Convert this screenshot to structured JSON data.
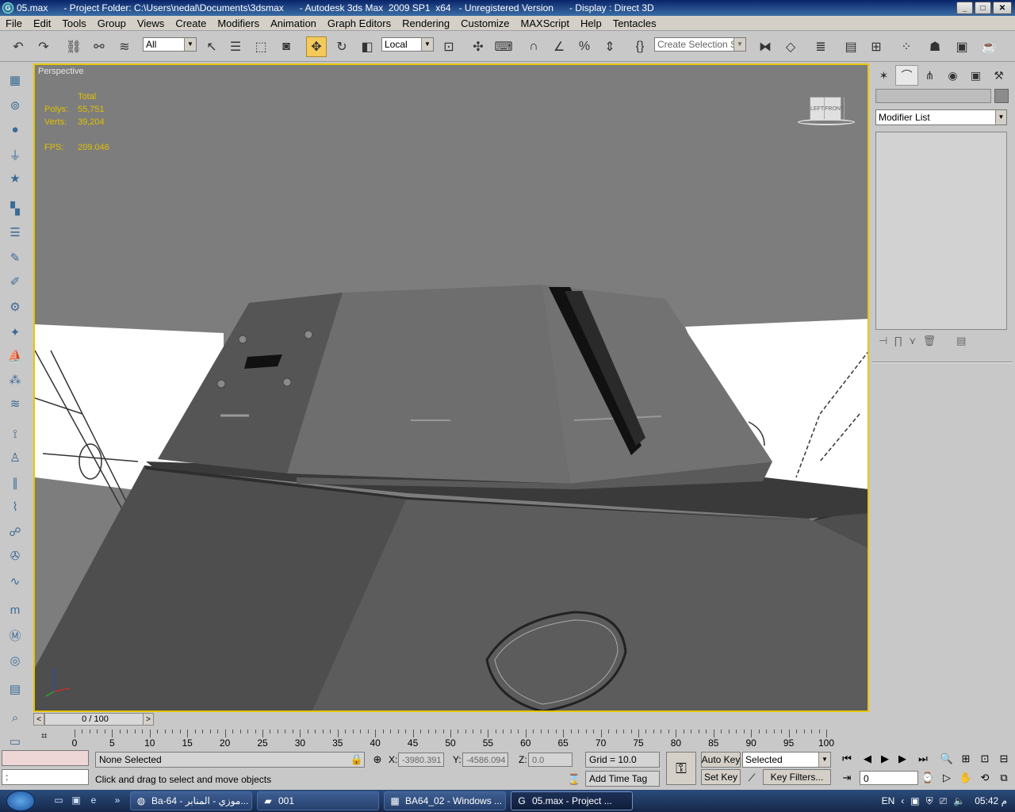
{
  "window": {
    "title": "05.max      - Project Folder: C:\\Users\\nedal\\Documents\\3dsmax      - Autodesk 3ds Max  2009 SP1  x64   - Unregistered Version      - Display : Direct 3D",
    "minimize": "_",
    "maximize": "□",
    "close": "✕"
  },
  "menu": [
    "File",
    "Edit",
    "Tools",
    "Group",
    "Views",
    "Create",
    "Modifiers",
    "Animation",
    "Graph Editors",
    "Rendering",
    "Customize",
    "MAXScript",
    "Help",
    "Tentacles"
  ],
  "toolbar": {
    "selection_filter": "All",
    "ref_coord": "Local",
    "named_selection_placeholder": "Create Selection Set"
  },
  "viewport": {
    "label": "Perspective",
    "stats": {
      "header": "Total",
      "polys_label": "Polys:",
      "polys": "55,751",
      "verts_label": "Verts:",
      "verts": "39,204",
      "fps_label": "FPS:",
      "fps": "209.046"
    },
    "viewcube_left": "LEFT",
    "viewcube_front": "FRONT"
  },
  "command_panel": {
    "modifier_list": "Modifier List"
  },
  "time_slider": {
    "position": "0 / 100",
    "prev": "<",
    "next": ">"
  },
  "trackbar": {
    "ticks": [
      "0",
      "5",
      "10",
      "15",
      "20",
      "25",
      "30",
      "35",
      "40",
      "45",
      "50",
      "55",
      "60",
      "65",
      "70",
      "75",
      "80",
      "85",
      "90",
      "95",
      "100"
    ]
  },
  "status": {
    "selection": "None Selected",
    "prompt": "Click and drag to select and move objects",
    "maxscript": ":",
    "x_label": "X:",
    "x": "-3980.391",
    "y_label": "Y:",
    "y": "-4586.094",
    "z_label": "Z:",
    "z": "0.0",
    "grid": "Grid = 10.0",
    "add_time_tag": "Add Time Tag",
    "auto_key": "Auto Key",
    "set_key": "Set Key",
    "key_mode": "Selected",
    "key_filters": "Key Filters...",
    "frame": "0"
  },
  "taskbar": {
    "tasks": [
      {
        "label": "Ba-64 - موزي - المنابر...",
        "icon": "firefox-icon"
      },
      {
        "label": "001",
        "icon": "folder-icon"
      },
      {
        "label": "BA64_02 - Windows ...",
        "icon": "image-viewer-icon"
      },
      {
        "label": "05.max     - Project ...",
        "icon": "3dsmax-icon"
      }
    ],
    "language": "EN",
    "clock": "05:42 م"
  },
  "colors": {
    "viewport_bg": "#7d7d7d",
    "active_border": "#e8c600",
    "stats_text": "#e0c000",
    "active_tool": "#f5c95a"
  }
}
